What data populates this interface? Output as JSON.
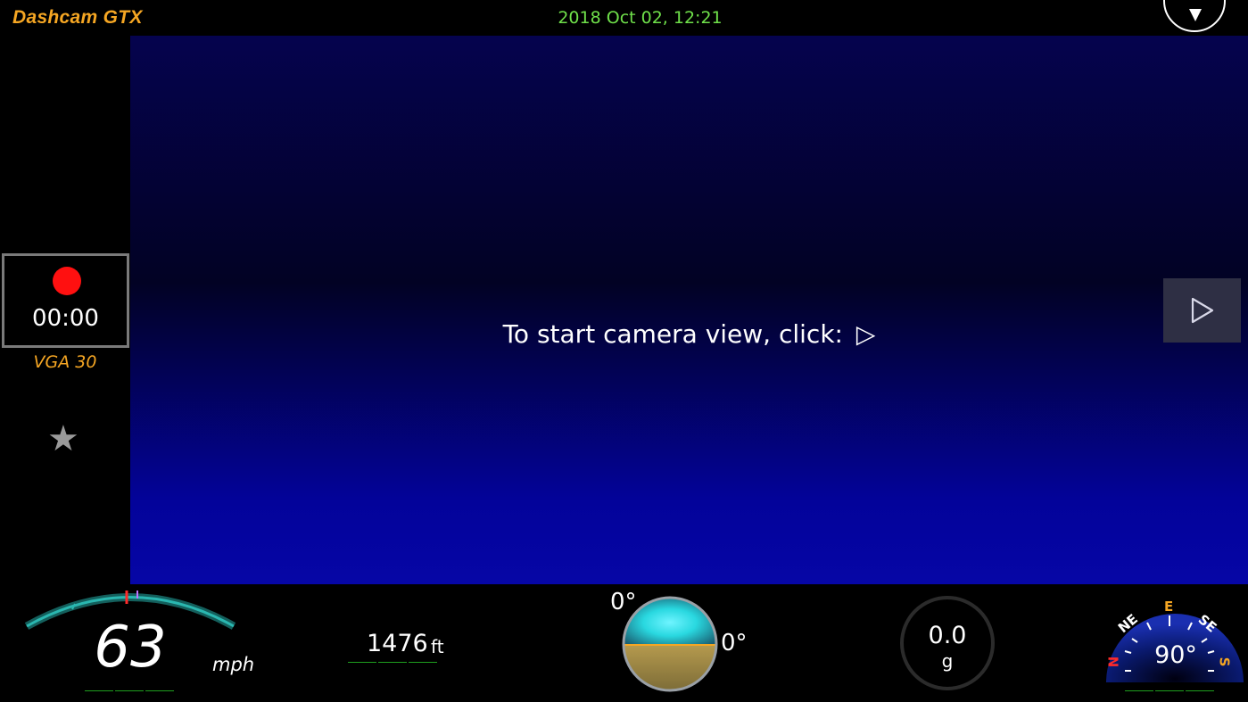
{
  "app": {
    "title": "Dashcam GTX",
    "datetime": "2018 Oct 02,  12:21",
    "menu_icon": "chevron-down-icon"
  },
  "camera": {
    "message": "To start camera view, click:",
    "message_icon": "▷",
    "play_icon": "play-icon"
  },
  "recording": {
    "status_color": "#ff1010",
    "elapsed": "00:00",
    "resolution": "VGA 30",
    "favorite_icon": "★"
  },
  "speed": {
    "value": "63",
    "unit": "mph",
    "accent": "#2ab7b0"
  },
  "altitude": {
    "value": "1476",
    "unit": "ft"
  },
  "attitude": {
    "pitch": "0°",
    "roll": "0°",
    "sky_color": "#29d8e0",
    "ground_color": "#b59a4e"
  },
  "gforce": {
    "value": "0.0",
    "unit": "g"
  },
  "compass": {
    "heading": "90°",
    "labels": {
      "ne": "NE",
      "e": "E",
      "se": "SE",
      "n": "N",
      "s": "S"
    },
    "north_color": "#ff2a2a",
    "east_color": "#f5a623"
  },
  "colors": {
    "title": "#f5a623",
    "datetime": "#6fe04a",
    "underline": "#1fa01f"
  }
}
